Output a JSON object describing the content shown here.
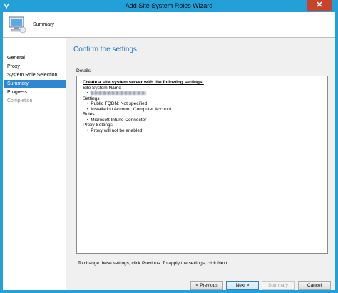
{
  "window": {
    "title": "Add Site System Roles Wizard",
    "close_glyph": "✕",
    "app_icon": "wizard-icon",
    "titlebar_color": "#24a0d8"
  },
  "header": {
    "title": "Summary",
    "icon": "computer-icon"
  },
  "sidebar": {
    "items": [
      {
        "label": "General",
        "state": "normal"
      },
      {
        "label": "Proxy",
        "state": "normal"
      },
      {
        "label": "System Role Selection",
        "state": "normal"
      },
      {
        "label": "Summary",
        "state": "active"
      },
      {
        "label": "Progress",
        "state": "normal"
      },
      {
        "label": "Completion",
        "state": "disabled"
      }
    ]
  },
  "main": {
    "heading": "Confirm the settings",
    "details_label": "Details:",
    "details": {
      "intro": "Create a site system server with the following settings:",
      "site_system_name_label": "Site System Name",
      "settings_label": "Settings",
      "public_fqdn": "Public FQDN: Not specified",
      "installation_account": "Installation Account: Computer Account",
      "roles_label": "Roles",
      "role_1": "Microsoft Intune Connector",
      "proxy_settings_label": "Proxy Settings",
      "proxy_value": "Proxy will not be enabled"
    },
    "footer_note": "To change these settings, click Previous. To apply the settings, click Next."
  },
  "buttons": {
    "previous": "< Previous",
    "next": "Next >",
    "summary": "Summary",
    "cancel": "Cancel"
  },
  "colors": {
    "accent": "#2f87d3",
    "heading": "#1f6fb4",
    "close": "#c7432c"
  }
}
